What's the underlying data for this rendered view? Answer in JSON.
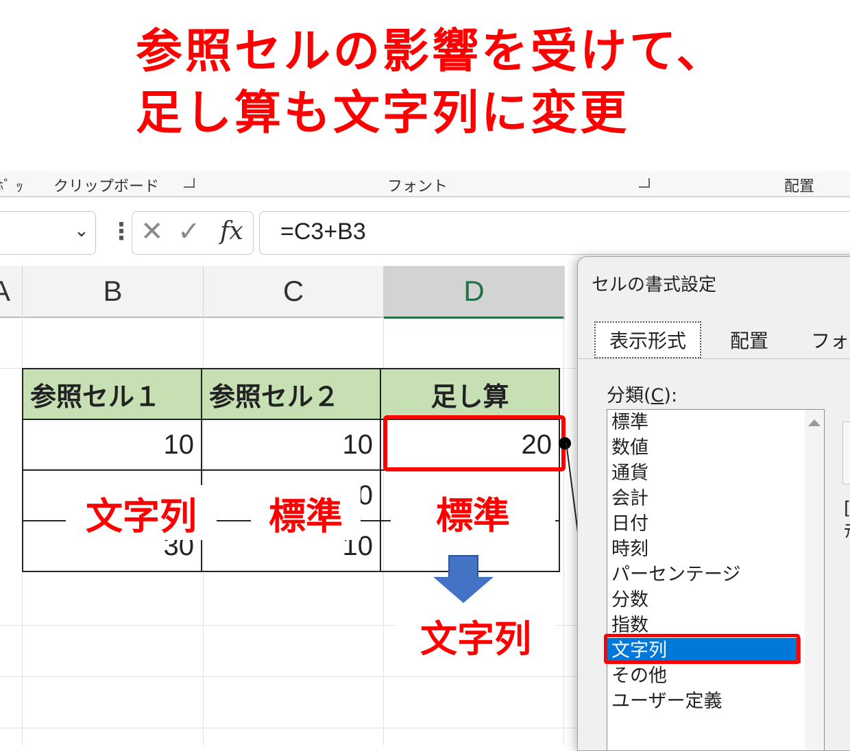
{
  "headline": {
    "line1": "参照セルの影響を受けて、",
    "line2": "足し算も文字列に変更"
  },
  "ribbon": {
    "group1": "ﾎﾞ ｯ",
    "group2": "クリップボード",
    "group3": "フォント",
    "group4": "配置"
  },
  "formula_bar": {
    "name_box": "",
    "cancel_symbol": "✕",
    "enter_symbol": "✓",
    "fx_symbol": "fx",
    "formula": "=C3+B3"
  },
  "columns": [
    "A",
    "B",
    "C",
    "D"
  ],
  "table": {
    "headers": [
      "参照セル１",
      "参照セル２",
      "足し算"
    ],
    "rows": [
      [
        "10",
        "10",
        "20"
      ],
      [
        "",
        "0",
        ""
      ],
      [
        "30",
        "10",
        ""
      ]
    ]
  },
  "annotations": {
    "col_b_format": "文字列",
    "col_c_format": "標準",
    "col_d_format": "標準",
    "result_format": "文字列"
  },
  "dialog": {
    "title": "セルの書式設定",
    "tabs": [
      "表示形式",
      "配置",
      "フォン"
    ],
    "category_label": "分類(",
    "category_key": "C",
    "category_label_end": "):",
    "categories": [
      "標準",
      "数値",
      "通貨",
      "会計",
      "日付",
      "時刻",
      "パーセンテージ",
      "分数",
      "指数",
      "文字列",
      "その他",
      "ユーザー定義"
    ],
    "selected_category": "文字列",
    "cut_text_1": "[",
    "cut_text_2": "ﾃ"
  },
  "colors": {
    "accent_red": "#ff0000",
    "header_green": "#c6e0b4",
    "excel_green": "#217346",
    "selection_blue": "#0078d7",
    "arrow_blue": "#4472c4"
  }
}
